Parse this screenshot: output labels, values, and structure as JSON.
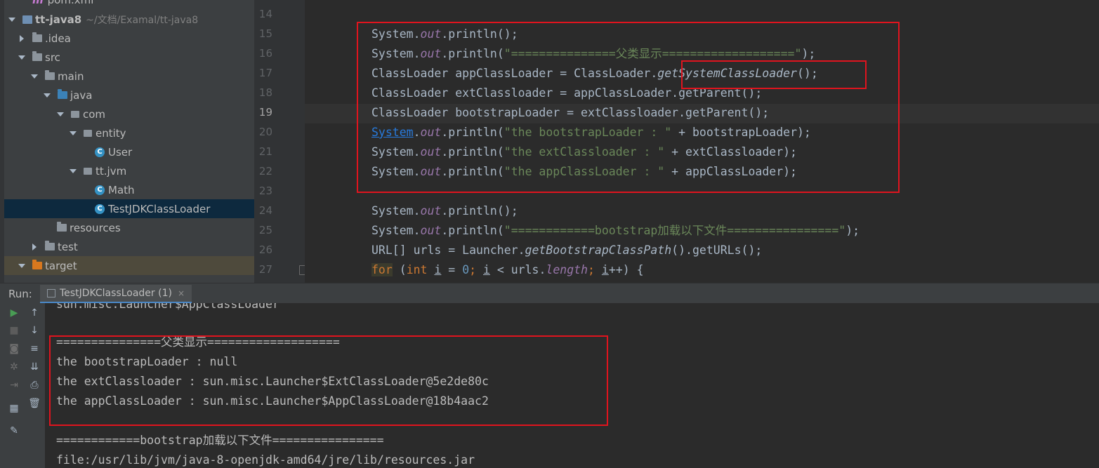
{
  "project_tree": {
    "items": [
      {
        "label": "pom.xml",
        "kind": "pom"
      },
      {
        "label": "tt-java8",
        "kind": "project",
        "path": "~/文档/Examal/tt-java8"
      },
      {
        "label": ".idea",
        "kind": "folder"
      },
      {
        "label": "src",
        "kind": "folder"
      },
      {
        "label": "main",
        "kind": "folder"
      },
      {
        "label": "java",
        "kind": "source-folder"
      },
      {
        "label": "com",
        "kind": "package"
      },
      {
        "label": "entity",
        "kind": "package"
      },
      {
        "label": "User",
        "kind": "class"
      },
      {
        "label": "tt.jvm",
        "kind": "package"
      },
      {
        "label": "Math",
        "kind": "class"
      },
      {
        "label": "TestJDKClassLoader",
        "kind": "class",
        "selected": true
      },
      {
        "label": "resources",
        "kind": "resources-folder"
      },
      {
        "label": "test",
        "kind": "folder"
      },
      {
        "label": "target",
        "kind": "excluded-folder"
      }
    ]
  },
  "editor": {
    "line_numbers": [
      "14",
      "15",
      "16",
      "17",
      "18",
      "19",
      "20",
      "21",
      "22",
      "23",
      "24",
      "25",
      "26",
      "27"
    ],
    "current_line": "19",
    "code": {
      "l15": {
        "a": "System.",
        "b": "out",
        "c": ".println();"
      },
      "l16": {
        "a": "System.",
        "b": "out",
        "c": ".println(",
        "d": "\"===============父类显示===================\"",
        "e": ");"
      },
      "l17": {
        "a": "ClassLoader appClassLoader = ClassLoader.",
        "b": "getSystemClassLoader",
        "c": "();"
      },
      "l18": {
        "a": "ClassLoader extClassloader = appClassLoader.getParent();"
      },
      "l19": {
        "a": "ClassLoader bootstrapLoader = extClassloader.getParent();"
      },
      "l20": {
        "a": "System",
        "b": ".",
        "c": "out",
        "d": ".println(",
        "e": "\"the bootstrapLoader : \"",
        "f": " + bootstrapLoader);"
      },
      "l21": {
        "a": "System.",
        "b": "out",
        "c": ".println(",
        "d": "\"the extClassloader : \"",
        "e": " + extClassloader);"
      },
      "l22": {
        "a": "System.",
        "b": "out",
        "c": ".println(",
        "d": "\"the appClassLoader : \"",
        "e": " + appClassLoader);"
      },
      "l24": {
        "a": "System.",
        "b": "out",
        "c": ".println();"
      },
      "l25": {
        "a": "System.",
        "b": "out",
        "c": ".println(",
        "d": "\"============bootstrap加载以下文件================\"",
        "e": ");"
      },
      "l26": {
        "a": "URL[] urls = Launcher.",
        "b": "getBootstrapClassPath",
        "c": "().getURLs();"
      },
      "l27": {
        "kw_for": "for",
        "p1": " (",
        "kw_int": "int",
        "sp": " ",
        "i1": "i",
        "eq": " = ",
        "zero": "0",
        "semi1": "; ",
        "i2": "i",
        "mid": " < urls.",
        "len": "length",
        "semi2": "; ",
        "i3": "i",
        "inc": "++) {"
      }
    }
  },
  "run_panel": {
    "label": "Run:",
    "tab_label": "TestJDKClassLoader (1)",
    "output": [
      "sun.misc.Launcher$AppClassLoader",
      "",
      "===============父类显示===================",
      "the bootstrapLoader : null",
      "the extClassloader : sun.misc.Launcher$ExtClassLoader@5e2de80c",
      "the appClassLoader : sun.misc.Launcher$AppClassLoader@18b4aac2",
      "",
      "============bootstrap加载以下文件================",
      "file:/usr/lib/jvm/java-8-openjdk-amd64/jre/lib/resources.jar"
    ],
    "toolbar_icons": [
      "run-icon",
      "up-arrow-icon",
      "stop-icon",
      "down-arrow-icon",
      "camera-icon",
      "soft-wrap-icon",
      "debug-icon",
      "scroll-to-end-icon",
      "exit-icon",
      "print-icon",
      "layout-icon",
      "trash-icon",
      "pin-icon"
    ]
  },
  "colors": {
    "highlight_box": "#e0141e",
    "selection": "#0d293e",
    "string": "#6a8759",
    "keyword": "#cc7832",
    "field": "#9876aa"
  }
}
